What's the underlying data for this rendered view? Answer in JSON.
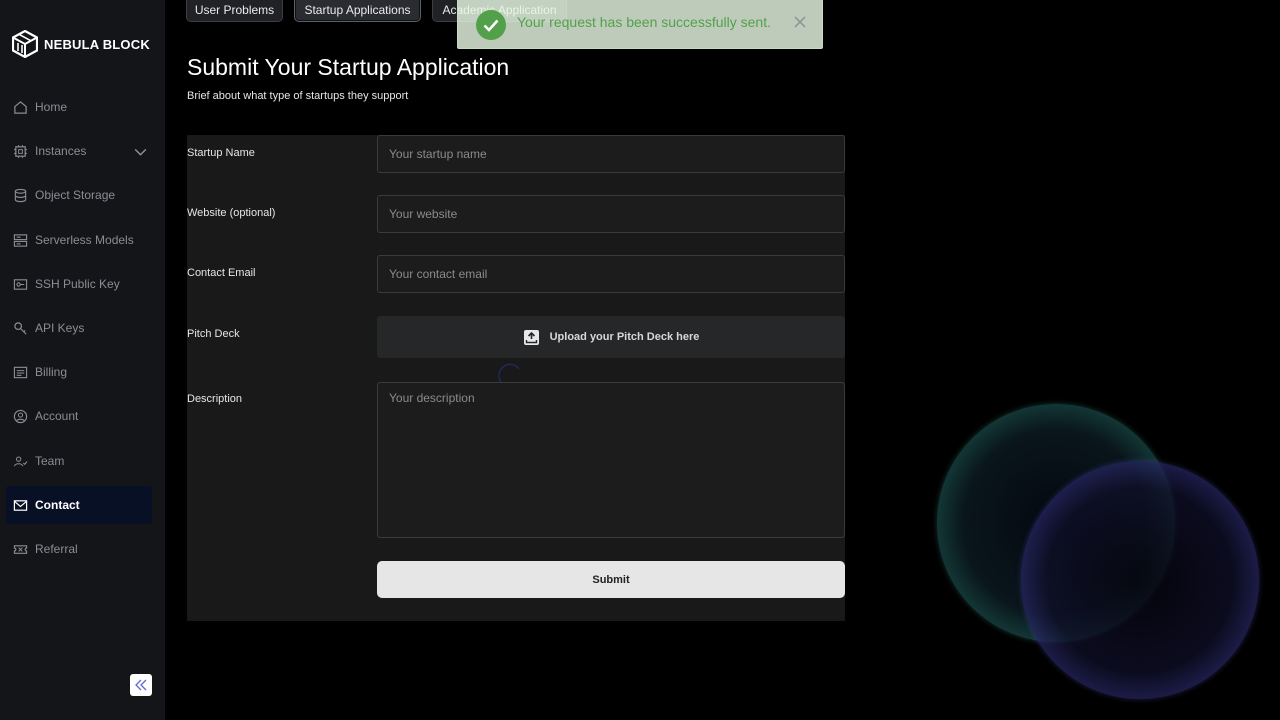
{
  "brand": {
    "name": "NEBULA BLOCK",
    "logo_icon": "cube-logo-icon"
  },
  "sidebar": {
    "items": [
      {
        "label": "Home",
        "icon": "home-icon"
      },
      {
        "label": "Instances",
        "icon": "chip-icon",
        "expandable": true
      },
      {
        "label": "Object Storage",
        "icon": "database-icon"
      },
      {
        "label": "Serverless Models",
        "icon": "server-icon"
      },
      {
        "label": "SSH Public Key",
        "icon": "key-card-icon"
      },
      {
        "label": "API Keys",
        "icon": "key-icon"
      },
      {
        "label": "Billing",
        "icon": "receipt-icon"
      },
      {
        "label": "Account",
        "icon": "user-circle-icon"
      },
      {
        "label": "Team",
        "icon": "team-icon"
      },
      {
        "label": "Contact",
        "icon": "mail-icon",
        "active": true
      },
      {
        "label": "Referral",
        "icon": "ticket-icon"
      }
    ],
    "collapse_icon": "double-chevron-left-icon"
  },
  "tabs": [
    {
      "label": "User Problems"
    },
    {
      "label": "Startup Applications",
      "active": true
    },
    {
      "label": "Academic Application"
    }
  ],
  "page": {
    "title": "Submit Your Startup Application",
    "subtitle": "Brief about what type of startups they support"
  },
  "form": {
    "startup_name": {
      "label": "Startup Name",
      "placeholder": "Your startup name",
      "value": ""
    },
    "website": {
      "label": "Website (optional)",
      "placeholder": "Your website",
      "value": ""
    },
    "contact_email": {
      "label": "Contact Email",
      "placeholder": "Your contact email",
      "value": ""
    },
    "pitch_deck": {
      "label": "Pitch Deck",
      "upload_label": "Upload your Pitch Deck here"
    },
    "description": {
      "label": "Description",
      "placeholder": "Your description",
      "value": ""
    },
    "submit_label": "Submit"
  },
  "toast": {
    "message": "Your request has been successfully sent.",
    "status": "success",
    "color": "#52a14a"
  }
}
